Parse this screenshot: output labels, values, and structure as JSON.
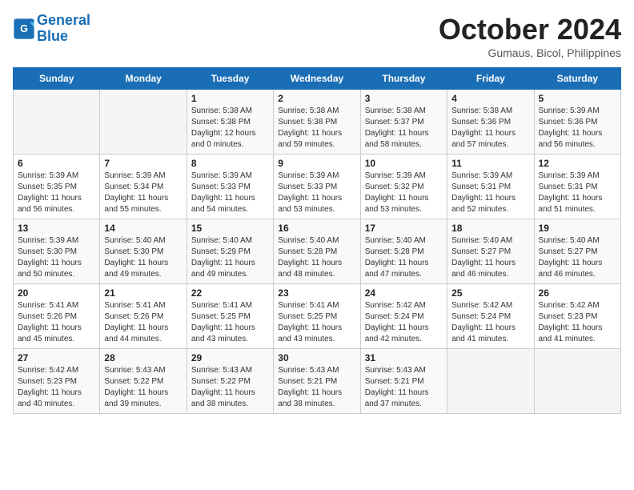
{
  "header": {
    "logo_line1": "General",
    "logo_line2": "Blue",
    "month": "October 2024",
    "location": "Gumaus, Bicol, Philippines"
  },
  "weekdays": [
    "Sunday",
    "Monday",
    "Tuesday",
    "Wednesday",
    "Thursday",
    "Friday",
    "Saturday"
  ],
  "weeks": [
    [
      {
        "day": "",
        "info": ""
      },
      {
        "day": "",
        "info": ""
      },
      {
        "day": "1",
        "info": "Sunrise: 5:38 AM\nSunset: 5:38 PM\nDaylight: 12 hours\nand 0 minutes."
      },
      {
        "day": "2",
        "info": "Sunrise: 5:38 AM\nSunset: 5:38 PM\nDaylight: 11 hours\nand 59 minutes."
      },
      {
        "day": "3",
        "info": "Sunrise: 5:38 AM\nSunset: 5:37 PM\nDaylight: 11 hours\nand 58 minutes."
      },
      {
        "day": "4",
        "info": "Sunrise: 5:38 AM\nSunset: 5:36 PM\nDaylight: 11 hours\nand 57 minutes."
      },
      {
        "day": "5",
        "info": "Sunrise: 5:39 AM\nSunset: 5:36 PM\nDaylight: 11 hours\nand 56 minutes."
      }
    ],
    [
      {
        "day": "6",
        "info": "Sunrise: 5:39 AM\nSunset: 5:35 PM\nDaylight: 11 hours\nand 56 minutes."
      },
      {
        "day": "7",
        "info": "Sunrise: 5:39 AM\nSunset: 5:34 PM\nDaylight: 11 hours\nand 55 minutes."
      },
      {
        "day": "8",
        "info": "Sunrise: 5:39 AM\nSunset: 5:33 PM\nDaylight: 11 hours\nand 54 minutes."
      },
      {
        "day": "9",
        "info": "Sunrise: 5:39 AM\nSunset: 5:33 PM\nDaylight: 11 hours\nand 53 minutes."
      },
      {
        "day": "10",
        "info": "Sunrise: 5:39 AM\nSunset: 5:32 PM\nDaylight: 11 hours\nand 53 minutes."
      },
      {
        "day": "11",
        "info": "Sunrise: 5:39 AM\nSunset: 5:31 PM\nDaylight: 11 hours\nand 52 minutes."
      },
      {
        "day": "12",
        "info": "Sunrise: 5:39 AM\nSunset: 5:31 PM\nDaylight: 11 hours\nand 51 minutes."
      }
    ],
    [
      {
        "day": "13",
        "info": "Sunrise: 5:39 AM\nSunset: 5:30 PM\nDaylight: 11 hours\nand 50 minutes."
      },
      {
        "day": "14",
        "info": "Sunrise: 5:40 AM\nSunset: 5:30 PM\nDaylight: 11 hours\nand 49 minutes."
      },
      {
        "day": "15",
        "info": "Sunrise: 5:40 AM\nSunset: 5:29 PM\nDaylight: 11 hours\nand 49 minutes."
      },
      {
        "day": "16",
        "info": "Sunrise: 5:40 AM\nSunset: 5:28 PM\nDaylight: 11 hours\nand 48 minutes."
      },
      {
        "day": "17",
        "info": "Sunrise: 5:40 AM\nSunset: 5:28 PM\nDaylight: 11 hours\nand 47 minutes."
      },
      {
        "day": "18",
        "info": "Sunrise: 5:40 AM\nSunset: 5:27 PM\nDaylight: 11 hours\nand 46 minutes."
      },
      {
        "day": "19",
        "info": "Sunrise: 5:40 AM\nSunset: 5:27 PM\nDaylight: 11 hours\nand 46 minutes."
      }
    ],
    [
      {
        "day": "20",
        "info": "Sunrise: 5:41 AM\nSunset: 5:26 PM\nDaylight: 11 hours\nand 45 minutes."
      },
      {
        "day": "21",
        "info": "Sunrise: 5:41 AM\nSunset: 5:26 PM\nDaylight: 11 hours\nand 44 minutes."
      },
      {
        "day": "22",
        "info": "Sunrise: 5:41 AM\nSunset: 5:25 PM\nDaylight: 11 hours\nand 43 minutes."
      },
      {
        "day": "23",
        "info": "Sunrise: 5:41 AM\nSunset: 5:25 PM\nDaylight: 11 hours\nand 43 minutes."
      },
      {
        "day": "24",
        "info": "Sunrise: 5:42 AM\nSunset: 5:24 PM\nDaylight: 11 hours\nand 42 minutes."
      },
      {
        "day": "25",
        "info": "Sunrise: 5:42 AM\nSunset: 5:24 PM\nDaylight: 11 hours\nand 41 minutes."
      },
      {
        "day": "26",
        "info": "Sunrise: 5:42 AM\nSunset: 5:23 PM\nDaylight: 11 hours\nand 41 minutes."
      }
    ],
    [
      {
        "day": "27",
        "info": "Sunrise: 5:42 AM\nSunset: 5:23 PM\nDaylight: 11 hours\nand 40 minutes."
      },
      {
        "day": "28",
        "info": "Sunrise: 5:43 AM\nSunset: 5:22 PM\nDaylight: 11 hours\nand 39 minutes."
      },
      {
        "day": "29",
        "info": "Sunrise: 5:43 AM\nSunset: 5:22 PM\nDaylight: 11 hours\nand 38 minutes."
      },
      {
        "day": "30",
        "info": "Sunrise: 5:43 AM\nSunset: 5:21 PM\nDaylight: 11 hours\nand 38 minutes."
      },
      {
        "day": "31",
        "info": "Sunrise: 5:43 AM\nSunset: 5:21 PM\nDaylight: 11 hours\nand 37 minutes."
      },
      {
        "day": "",
        "info": ""
      },
      {
        "day": "",
        "info": ""
      }
    ]
  ]
}
